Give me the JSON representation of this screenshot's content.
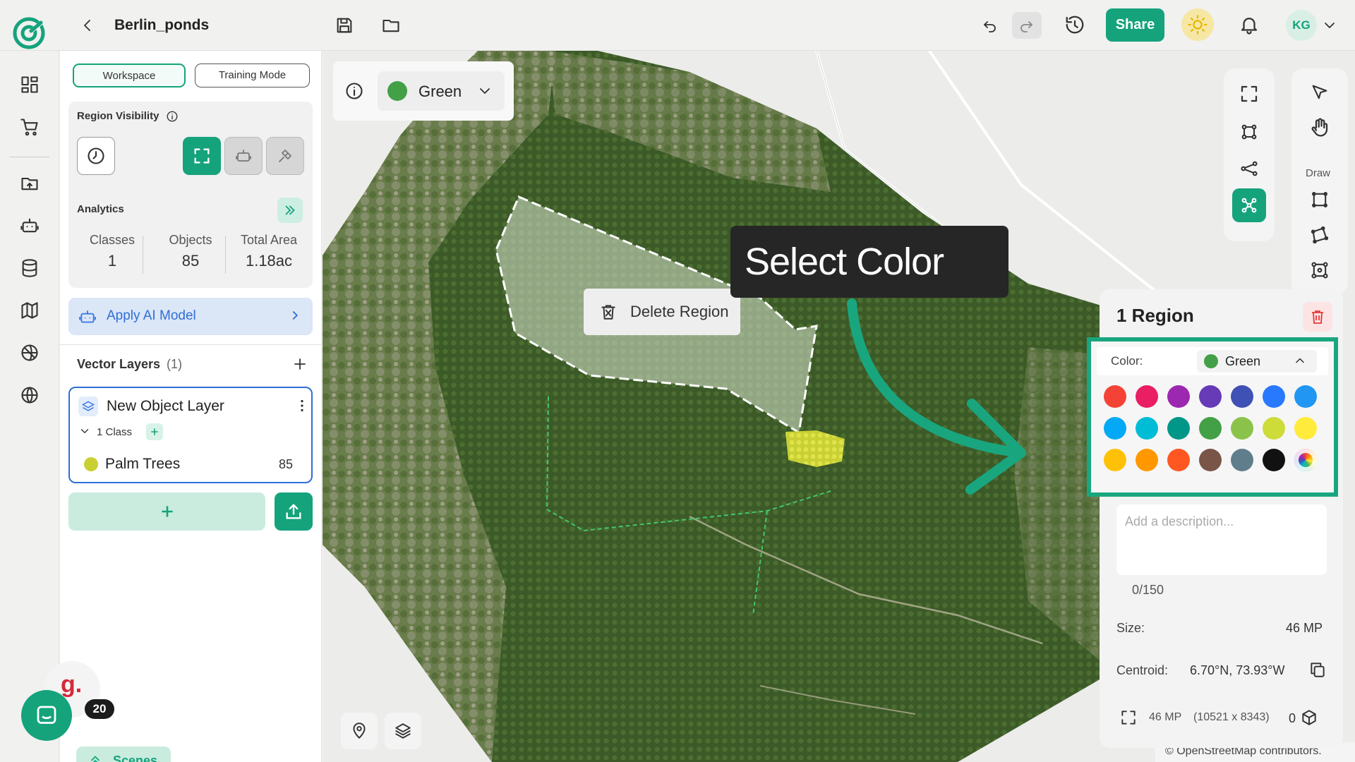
{
  "topbar": {
    "title": "Berlin_ponds",
    "share_label": "Share",
    "avatar_initials": "KG"
  },
  "left_panel": {
    "tabs": [
      "Workspace",
      "Training Mode"
    ],
    "region_visibility_label": "Region Visibility",
    "analytics": {
      "title": "Analytics",
      "stats": [
        {
          "label": "Classes",
          "value": "1"
        },
        {
          "label": "Objects",
          "value": "85"
        },
        {
          "label": "Total Area",
          "value": "1.18ac"
        }
      ]
    },
    "apply_ai_label": "Apply AI Model",
    "vector_layers_label": "Vector Layers",
    "vector_layers_count": "(1)",
    "layer": {
      "name": "New Object Layer",
      "class_count": "1 Class",
      "class_name": "Palm Trees",
      "class_value": "85",
      "class_color": "#c9d033"
    }
  },
  "chat_badge": "20",
  "grammarly_letter": "g.",
  "scenes_label": "Scenes",
  "map": {
    "color_selector_label": "Green",
    "delete_region_label": "Delete Region",
    "tooltip": "Select Color",
    "draw_label": "Draw",
    "attribution": "© OpenStreetMap contributors."
  },
  "region_panel": {
    "title": "1 Region",
    "color_label": "Color:",
    "color_value": "Green",
    "swatches": [
      "#f44336",
      "#e91e63",
      "#9c27b0",
      "#673ab7",
      "#3f51b5",
      "#2979ff",
      "#2196f3",
      "#03a9f4",
      "#00bcd4",
      "#009688",
      "#43a047",
      "#8bc34a",
      "#cddc39",
      "#ffeb3b",
      "#ffc107",
      "#ff9800",
      "#ff5722",
      "#795548",
      "#607d8b",
      "#111111",
      "rainbow"
    ],
    "description_placeholder": "Add a description...",
    "char_count": "0/150",
    "size_label": "Size:",
    "size_value": "46 MP",
    "centroid_label": "Centroid:",
    "centroid_value": "6.70°N, 73.93°W",
    "footer_mp": "46 MP",
    "footer_dims": "(10521 x 8343)",
    "footer_count": "0"
  },
  "colors": {
    "accent": "#10a37f",
    "highlight": "#19a67e",
    "selected_green": "#43a047"
  }
}
